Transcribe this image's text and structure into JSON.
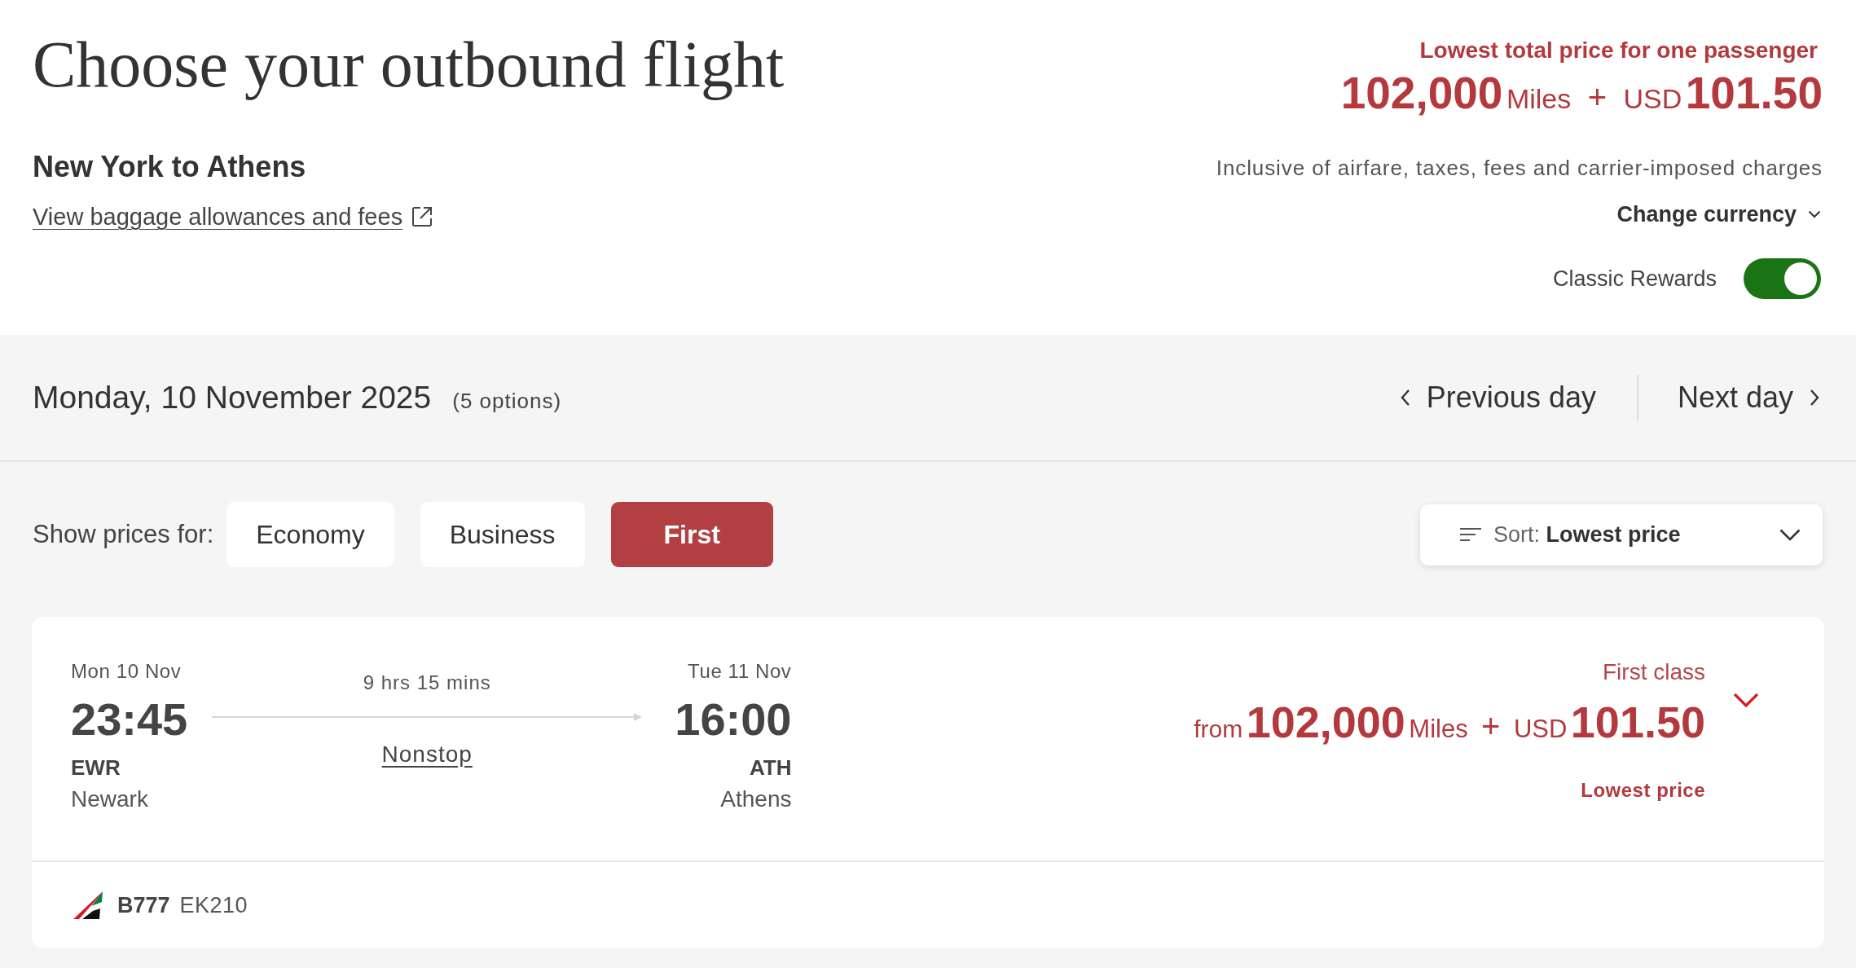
{
  "header": {
    "title": "Choose your outbound flight",
    "route": "New York to Athens",
    "baggage_link": "View baggage allowances and fees"
  },
  "price_summary": {
    "label": "Lowest total price for one passenger",
    "miles": "102,000",
    "miles_unit": "Miles",
    "plus": "+",
    "currency": "USD",
    "amount": "101.50",
    "note": "Inclusive of airfare, taxes, fees and carrier-imposed charges",
    "change_currency": "Change currency",
    "classic_rewards": {
      "label": "Classic Rewards",
      "on": true
    }
  },
  "date_bar": {
    "date": "Monday, 10 November 2025",
    "options": "(5 options)",
    "previous": "Previous day",
    "next": "Next day"
  },
  "cabin_filter": {
    "label": "Show prices for:",
    "cabins": [
      {
        "label": "Economy",
        "selected": false
      },
      {
        "label": "Business",
        "selected": false
      },
      {
        "label": "First",
        "selected": true
      }
    ]
  },
  "sort": {
    "label": "Sort:",
    "value": "Lowest price"
  },
  "flights": [
    {
      "departure": {
        "date": "Mon 10 Nov",
        "time": "23:45",
        "code": "EWR",
        "city": "Newark"
      },
      "duration": "9 hrs 15 mins",
      "stops": "Nonstop",
      "arrival": {
        "date": "Tue 11 Nov",
        "time": "16:00",
        "code": "ATH",
        "city": "Athens"
      },
      "fare": {
        "cabin": "First class",
        "prefix": "from",
        "miles": "102,000",
        "miles_unit": "Miles",
        "plus": "+",
        "currency": "USD",
        "amount": "101.50",
        "tag": "Lowest price"
      },
      "expanded": false,
      "aircraft": "B777",
      "flight_number": "EK210"
    }
  ]
}
